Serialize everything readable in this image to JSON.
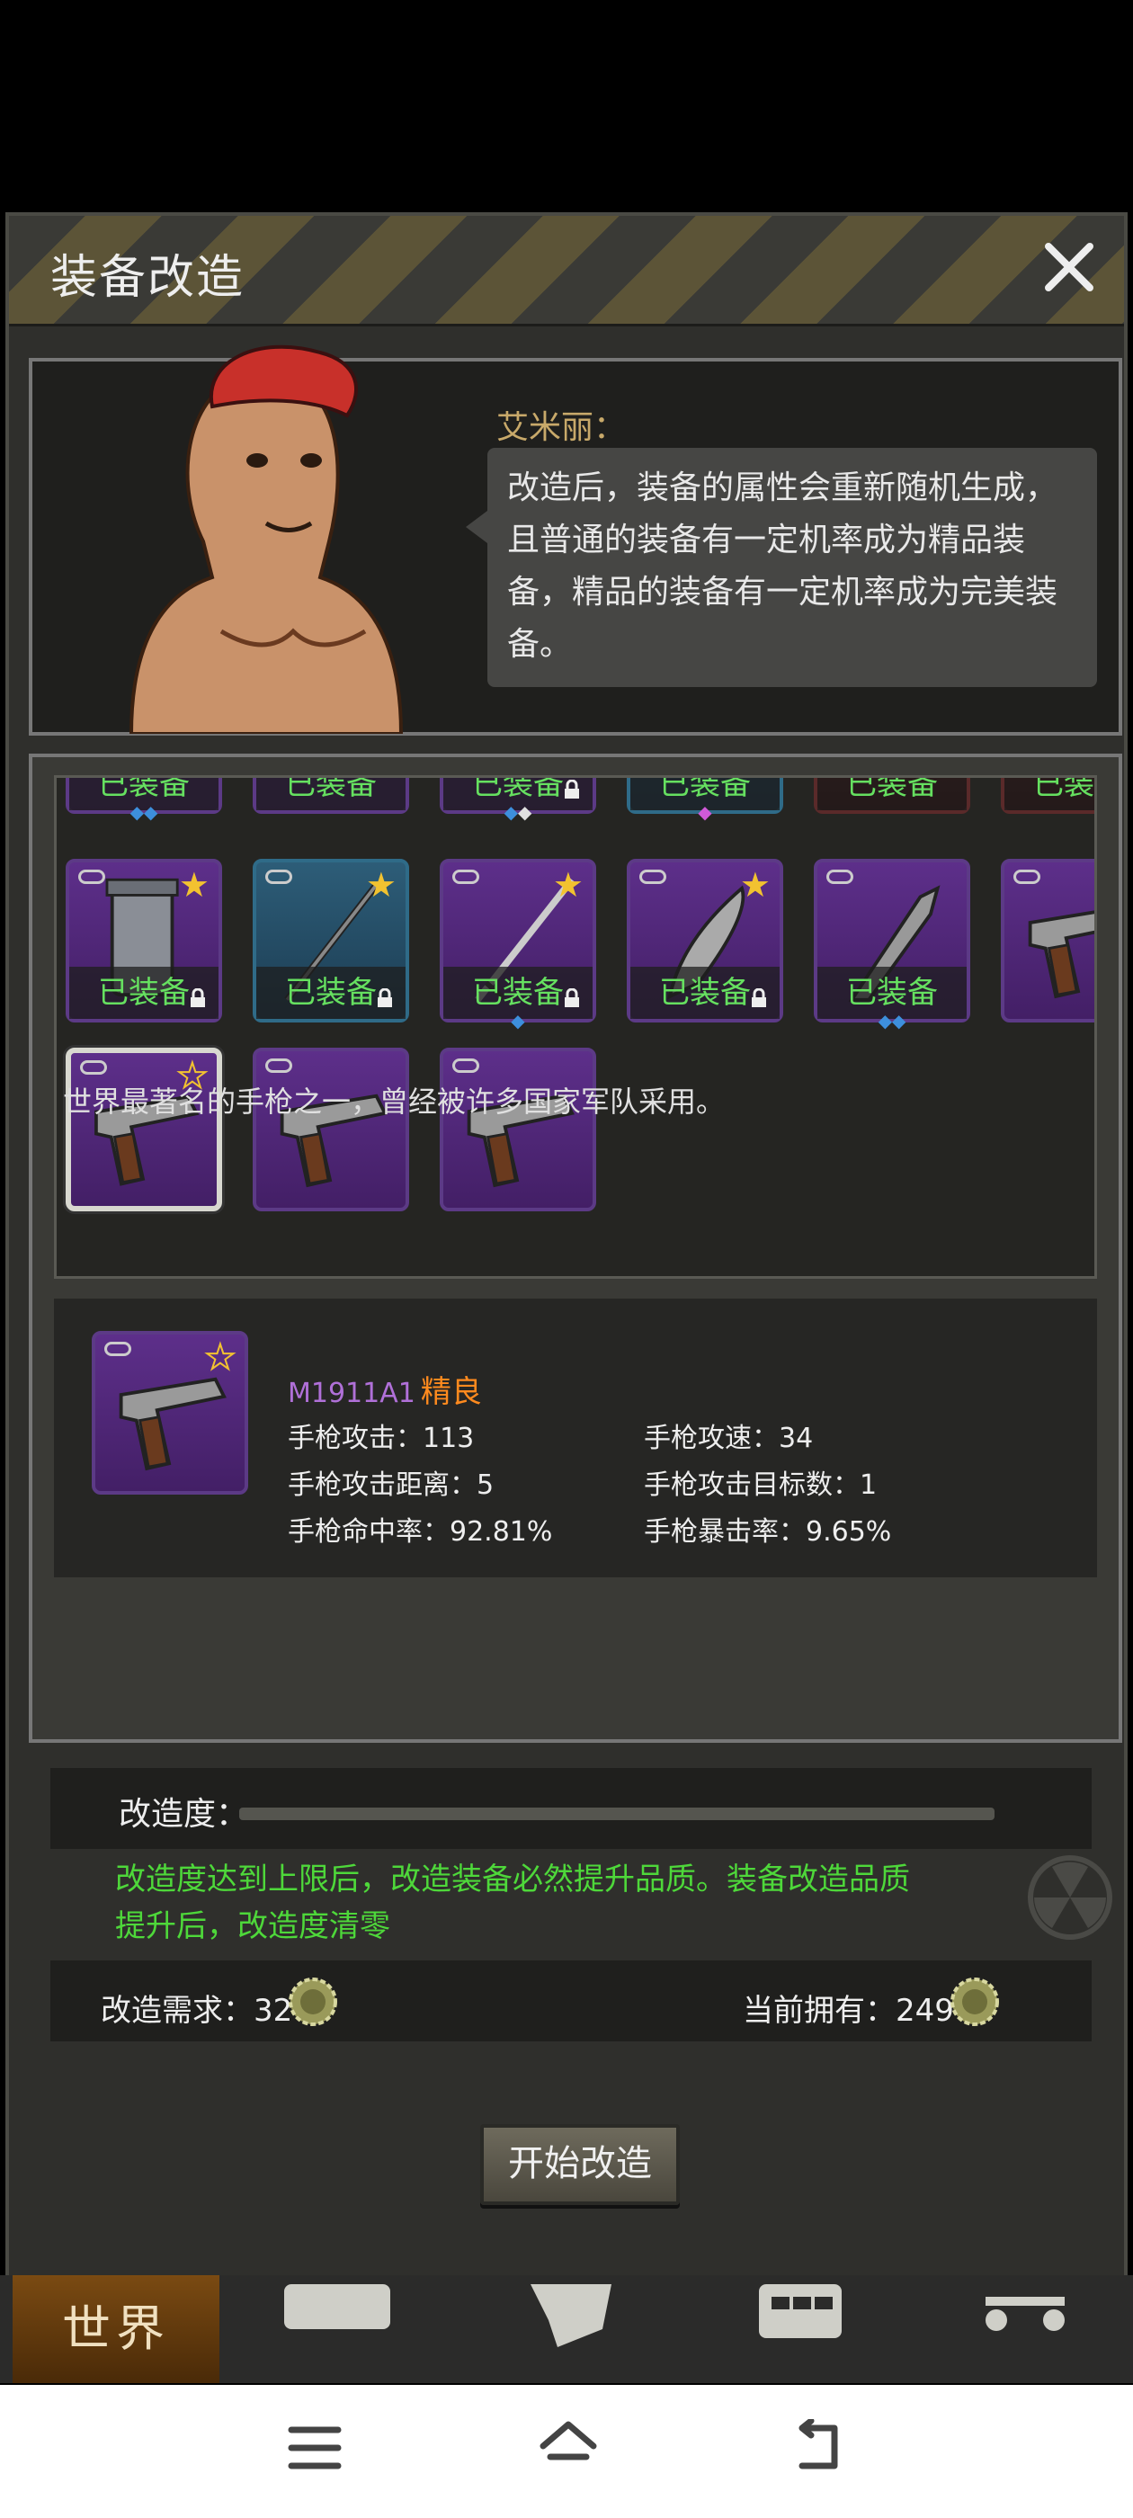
{
  "dialog": {
    "title": "装备改造"
  },
  "npc": {
    "name": "艾米丽：",
    "speech": "改造后，装备的属性会重新随机生成，且普通的装备有一定机率成为精品装备，精品的装备有一定机率成为完美装备。"
  },
  "inventory": {
    "equipped_label": "已装备",
    "row1": [
      {
        "color": "purple",
        "gems": [
          "blue",
          "blue"
        ]
      },
      {
        "color": "purple",
        "gems": []
      },
      {
        "color": "purple",
        "gems": [
          "blue",
          "white"
        ],
        "locked": true
      },
      {
        "color": "blue",
        "gems": [
          "pink"
        ]
      },
      {
        "color": "red",
        "gems": []
      },
      {
        "color": "red",
        "gems": []
      }
    ],
    "row2": [
      {
        "color": "purple",
        "icon": "canister-icon",
        "star": "filled",
        "locked": true,
        "equipped": true
      },
      {
        "color": "blue",
        "icon": "spear-icon",
        "star": "filled",
        "locked": true,
        "equipped": true
      },
      {
        "color": "purple",
        "icon": "sword-icon",
        "star": "filled",
        "locked": true,
        "equipped": true,
        "gems": [
          "blue"
        ]
      },
      {
        "color": "purple",
        "icon": "machete-icon",
        "star": "filled",
        "locked": true,
        "equipped": true
      },
      {
        "color": "purple",
        "icon": "knife-icon",
        "equipped": true,
        "gems": [
          "blue",
          "blue"
        ]
      },
      {
        "color": "purple",
        "icon": "pistol-icon"
      }
    ],
    "row3": [
      {
        "color": "purple",
        "icon": "pistol-icon",
        "star": "hollow",
        "selected": true
      },
      {
        "color": "purple",
        "icon": "pistol-icon"
      },
      {
        "color": "purple",
        "icon": "pistol-icon"
      }
    ]
  },
  "item": {
    "name": "M1911A1",
    "quality": "精良",
    "stats": {
      "attack": "手枪攻击：113",
      "speed": "手枪攻速：34",
      "range": "手枪攻击距离：5",
      "targets": "手枪攻击目标数：1",
      "hit": "手枪命中率：92.81%",
      "crit": "手枪暴击率：9.65%"
    },
    "description": "世界最著名的手枪之一，曾经被许多国家军队采用。"
  },
  "modification": {
    "label": "改造度：",
    "progress": 0,
    "hint": "改造度达到上限后，改造装备必然提升品质。装备改造品质提升后，改造度清零",
    "cost_label": "改造需求：32",
    "own_label": "当前拥有：249",
    "start_button": "开始改造"
  },
  "game_nav": {
    "world": "世界"
  },
  "colors": {
    "accent_green": "#4ed83a",
    "quality_orange": "#ff8a1e",
    "item_purple": "#b070d8"
  }
}
